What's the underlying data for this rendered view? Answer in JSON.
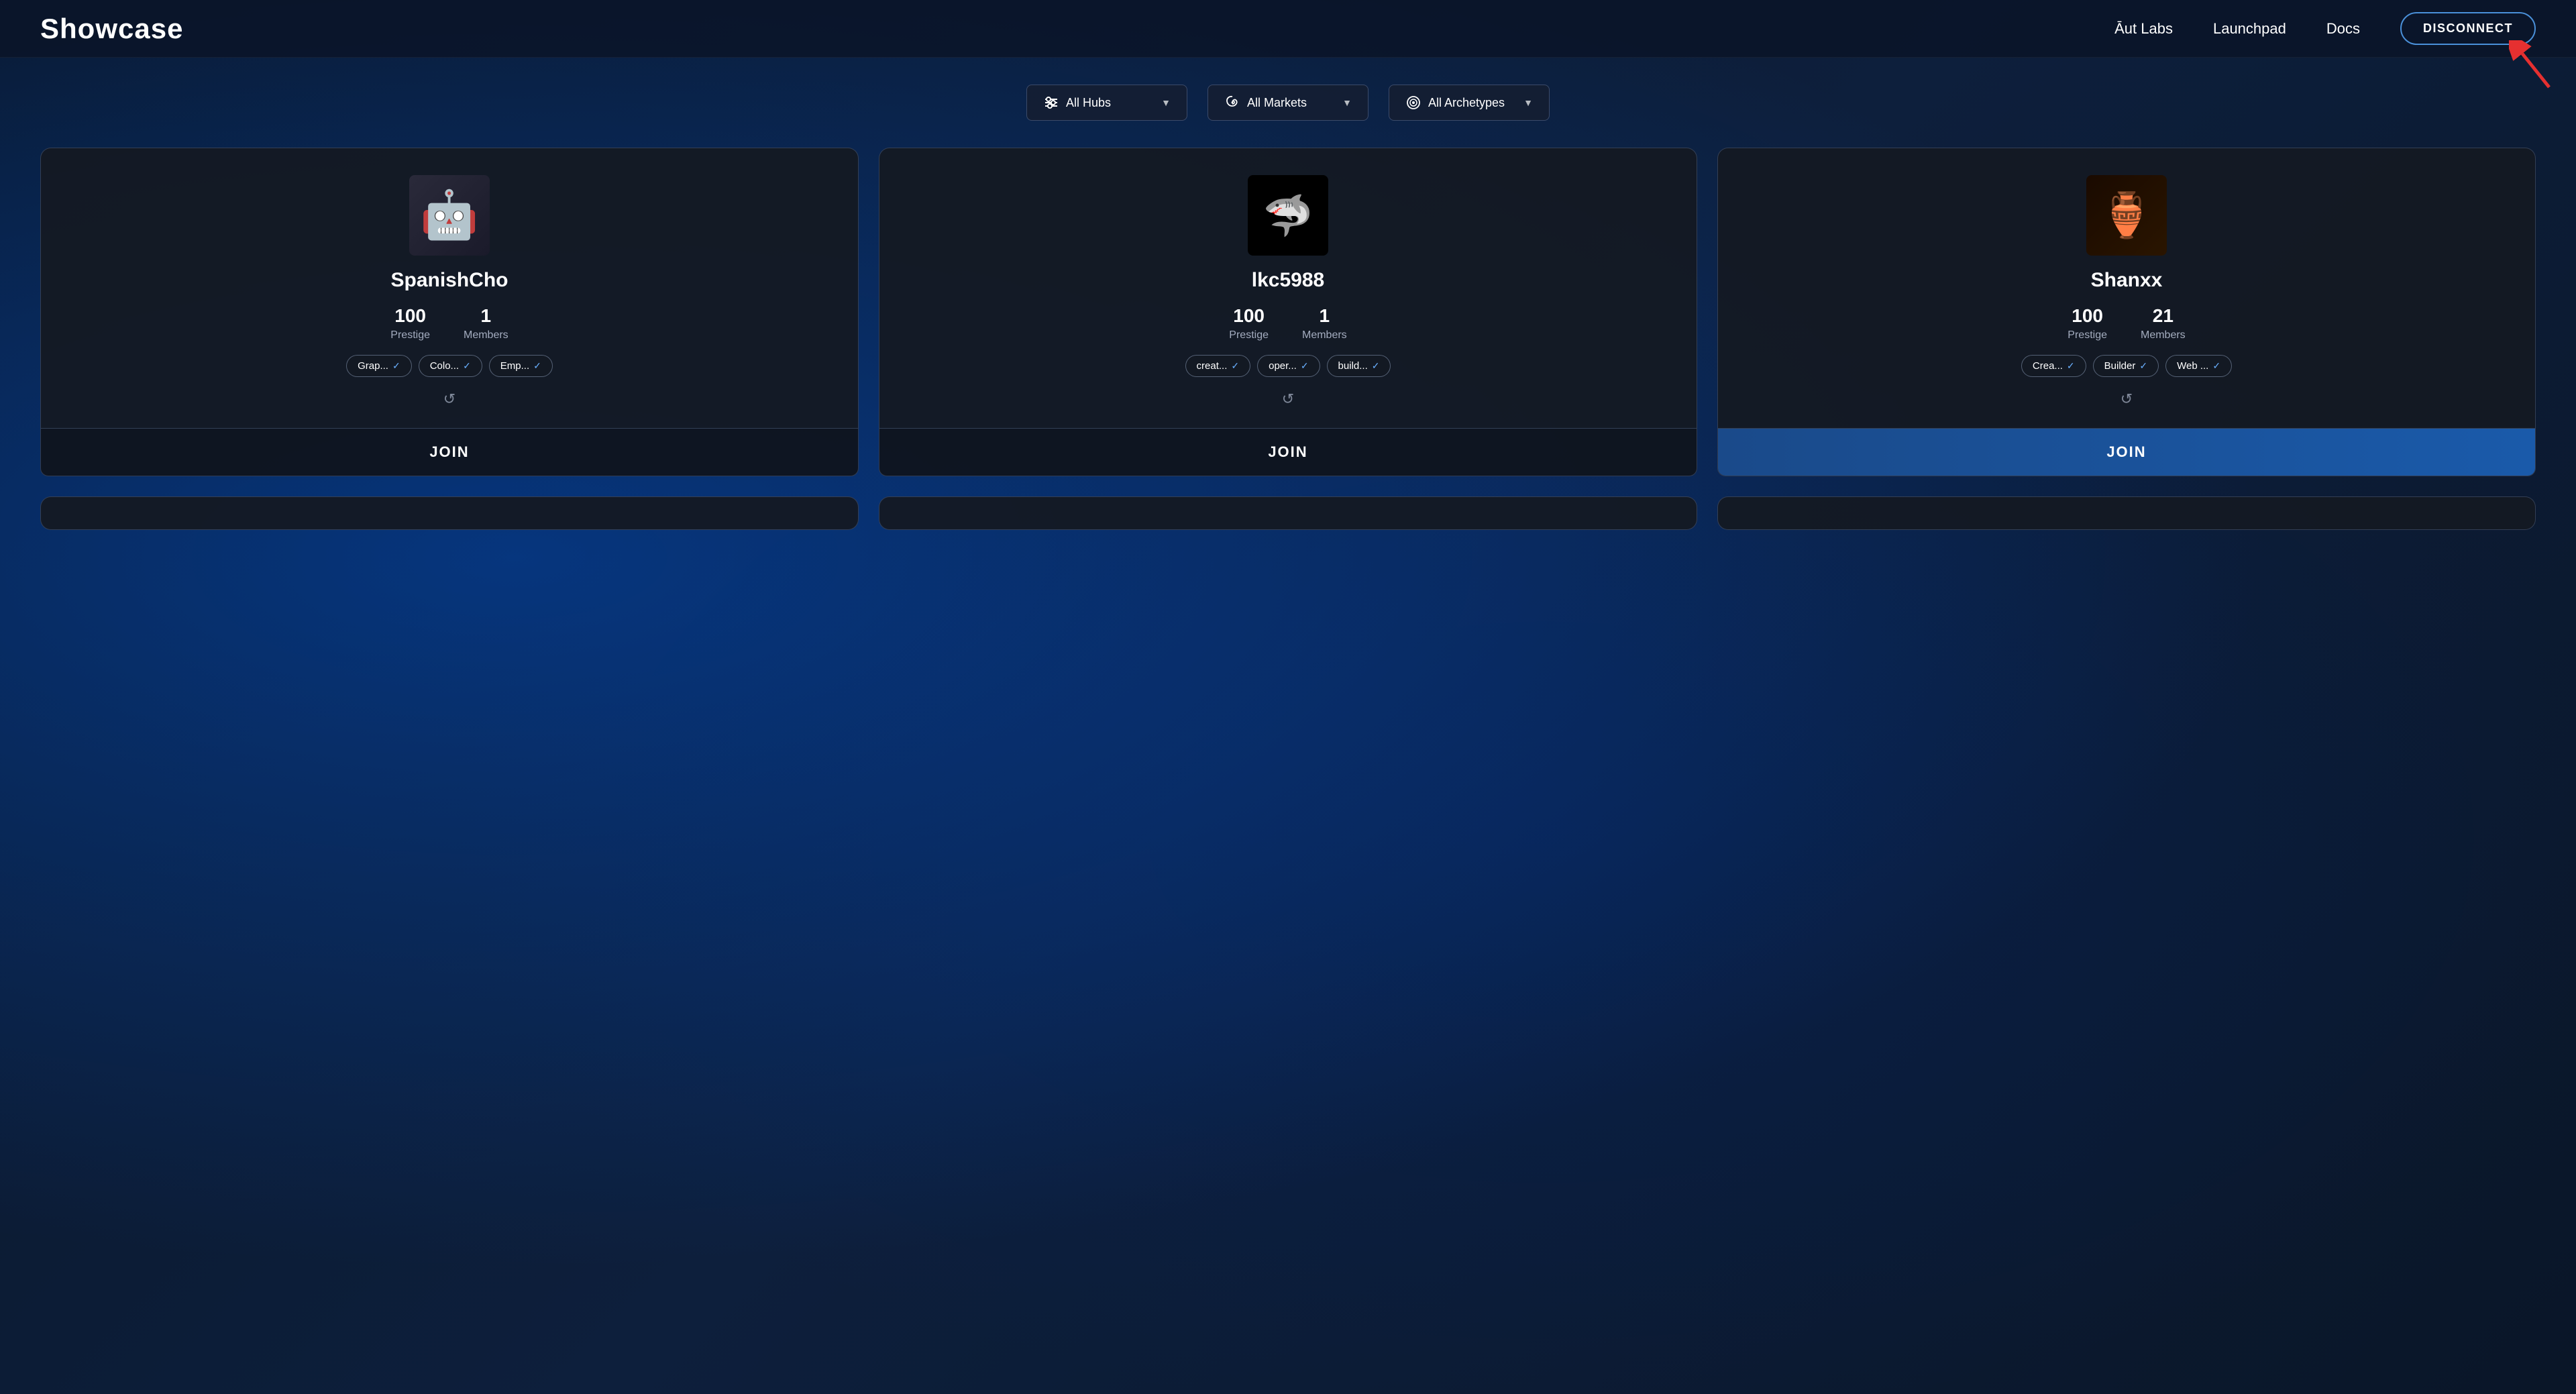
{
  "header": {
    "logo": "Showcase",
    "nav": [
      {
        "label": "Āut Labs",
        "id": "aut-labs"
      },
      {
        "label": "Launchpad",
        "id": "launchpad"
      },
      {
        "label": "Docs",
        "id": "docs"
      }
    ],
    "disconnect_label": "DISCONNECT"
  },
  "filters": [
    {
      "id": "all-hubs",
      "label": "All Hubs",
      "icon": "sliders-icon",
      "has_dropdown": true
    },
    {
      "id": "all-markets",
      "label": "All Markets",
      "icon": "spiral-icon",
      "has_dropdown": true
    },
    {
      "id": "all-archetypes",
      "label": "All Archetypes",
      "icon": "target-icon",
      "has_dropdown": true
    }
  ],
  "cards": [
    {
      "id": "spanishcho",
      "username": "SpanishCho",
      "prestige": "100",
      "prestige_label": "Prestige",
      "members": "1",
      "members_label": "Members",
      "tags": [
        {
          "label": "Grap...",
          "checked": true
        },
        {
          "label": "Colo...",
          "checked": true
        },
        {
          "label": "Emp...",
          "checked": true
        }
      ],
      "join_label": "JOIN",
      "join_highlighted": false,
      "avatar_type": "robot"
    },
    {
      "id": "lkc5988",
      "username": "lkc5988",
      "prestige": "100",
      "prestige_label": "Prestige",
      "members": "1",
      "members_label": "Members",
      "tags": [
        {
          "label": "creat...",
          "checked": true
        },
        {
          "label": "oper...",
          "checked": true
        },
        {
          "label": "build...",
          "checked": true
        }
      ],
      "join_label": "JOIN",
      "join_highlighted": false,
      "avatar_type": "shark"
    },
    {
      "id": "shanxx",
      "username": "Shanxx",
      "prestige": "100",
      "prestige_label": "Prestige",
      "members": "21",
      "members_label": "Members",
      "tags": [
        {
          "label": "Crea...",
          "checked": true
        },
        {
          "label": "Builder",
          "checked": true
        },
        {
          "label": "Web ...",
          "checked": true
        }
      ],
      "join_label": "JOIN",
      "join_highlighted": true,
      "avatar_type": "lamp"
    }
  ],
  "partial_cards": [
    {
      "id": "partial-1"
    },
    {
      "id": "partial-2"
    },
    {
      "id": "partial-3"
    }
  ]
}
